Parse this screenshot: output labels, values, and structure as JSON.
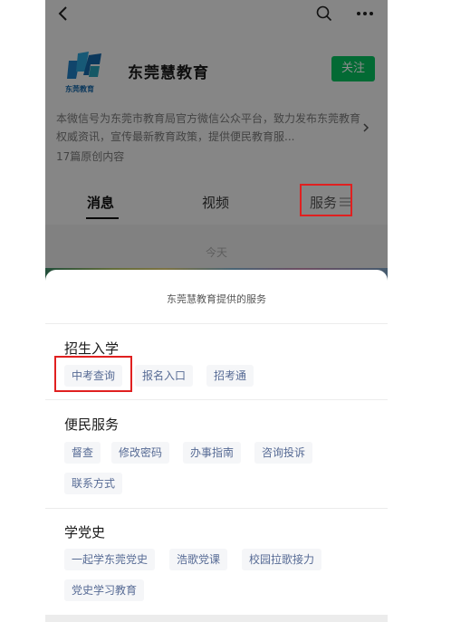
{
  "account": {
    "name": "东莞慧教育",
    "follow_label": "关注",
    "description": "本微信号为东莞市教育局官方微信公众平台，致力发布东莞教育权威资讯，宣传最新教育政策，提供便民教育服...",
    "original_count": "17篇原创内容",
    "logo_text": "东莞教育"
  },
  "tabs": [
    {
      "label": "消息"
    },
    {
      "label": "视频"
    },
    {
      "label": "服务"
    }
  ],
  "feed": {
    "date_label": "今天"
  },
  "service_sheet": {
    "title": "东莞慧教育提供的服务",
    "sections": [
      {
        "title": "招生入学",
        "items": [
          "中考查询",
          "报名入口",
          "招考通"
        ]
      },
      {
        "title": "便民服务",
        "items": [
          "督查",
          "修改密码",
          "办事指南",
          "咨询投诉",
          "联系方式"
        ]
      },
      {
        "title": "学党史",
        "items": [
          "一起学东莞党史",
          "浩歌党课",
          "校园拉歌接力",
          "党史学习教育"
        ]
      }
    ]
  },
  "colors": {
    "follow_green": "#07c160",
    "chip_text": "#576b95",
    "highlight_red": "#e02020"
  },
  "icons": [
    "back-icon",
    "search-icon",
    "more-icon",
    "chevron-right-icon",
    "menu-icon"
  ]
}
